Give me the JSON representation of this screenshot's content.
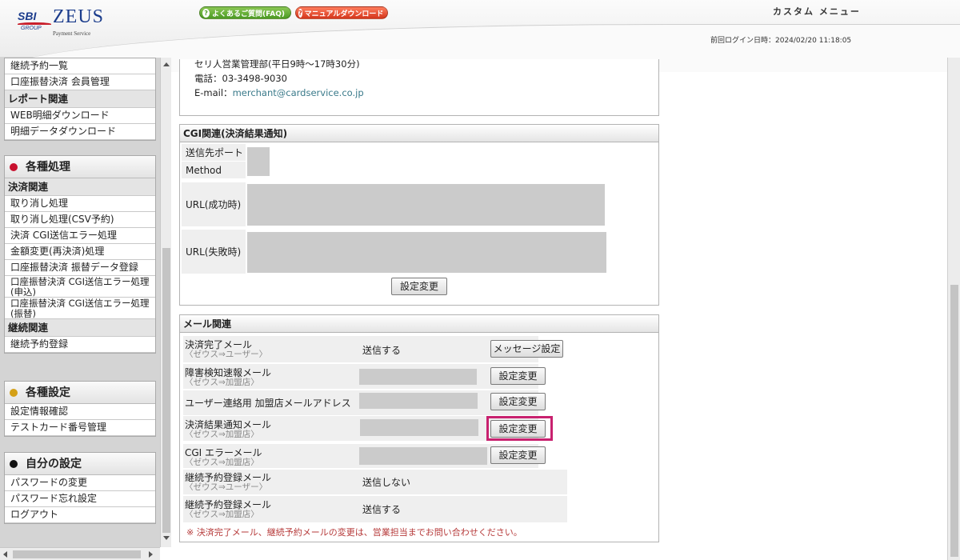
{
  "header": {
    "logo_sbi": "SBI",
    "logo_sbi_sub": "GROUP",
    "logo_zeus": "ZEUS",
    "logo_zeus_sub": "Payment Service",
    "faq_button": "よくあるご質問(FAQ)",
    "manual_button": "マニュアルダウンロード",
    "custom_menu": "カスタム メニュー",
    "last_login": "前回ログイン日時：2024/02/20 11:18:05"
  },
  "sidebar": {
    "top_items": [
      "継続予約一覧",
      "口座振替決済 会員管理"
    ],
    "report_category": "レポート関連",
    "report_items": [
      "WEB明細ダウンロード",
      "明細データダウンロード"
    ],
    "processing_header": "各種処理",
    "settlement_category": "決済関連",
    "settlement_items": [
      "取り消し処理",
      "取り消し処理(CSV予約)",
      "決済 CGI送信エラー処理",
      "金額変更(再決済)処理",
      "口座振替決済 振替データ登録"
    ],
    "settlement_two_line": [
      "口座振替決済 CGI送信エラー処理(申込)",
      "口座振替決済 CGI送信エラー処理(振替)"
    ],
    "continuation_category": "継続関連",
    "continuation_items": [
      "継続予約登録"
    ],
    "settings_header": "各種設定",
    "settings_items": [
      "設定情報確認",
      "テストカード番号管理"
    ],
    "my_settings_header": "自分の設定",
    "my_settings_items": [
      "パスワードの変更",
      "パスワード忘れ設定",
      "ログアウト"
    ]
  },
  "contact": {
    "line1": "セリ人営業管理部(平日9時〜17時30分)",
    "phone_label": "電話：03-3498-9030",
    "email_label": "E-mail：",
    "email": "merchant@cardservice.co.jp"
  },
  "cgi": {
    "title": "CGI関連(決済結果通知)",
    "port_label": "送信先ポート",
    "method_label": "Method",
    "success_label": "URL(成功時)",
    "failure_label": "URL(失敗時)",
    "change_button": "設定変更"
  },
  "mail": {
    "title": "メール関連",
    "rows": [
      {
        "title": "決済完了メール",
        "sub": "〈ゼウス⇒ユーザー〉",
        "status": "送信する",
        "button": "メッセージ設定"
      },
      {
        "title": "障害検知速報メール",
        "sub": "〈ゼウス⇒加盟店〉",
        "status": "",
        "button": "設定変更"
      },
      {
        "title": "ユーザー連絡用 加盟店メールアドレス",
        "sub": "",
        "status": "",
        "button": "設定変更"
      },
      {
        "title": "決済結果通知メール",
        "sub": "〈ゼウス⇒加盟店〉",
        "status": "",
        "button": "設定変更"
      },
      {
        "title": "CGI エラーメール",
        "sub": "〈ゼウス⇒加盟店〉",
        "status": "",
        "button": "設定変更"
      },
      {
        "title": "継続予約登録メール",
        "sub": "〈ゼウス⇒ユーザー〉",
        "status": "送信しない",
        "button": ""
      },
      {
        "title": "継続予約登録メール",
        "sub": "〈ゼウス⇒加盟店〉",
        "status": "送信する",
        "button": ""
      }
    ],
    "note": "※ 決済完了メール、継続予約メールの変更は、営業担当までお問い合わせください。"
  },
  "colors": {
    "highlight": "#c8216f",
    "processing_dot": "#c8102e",
    "settings_dot": "#d4a017",
    "my_settings_dot": "#111111"
  }
}
